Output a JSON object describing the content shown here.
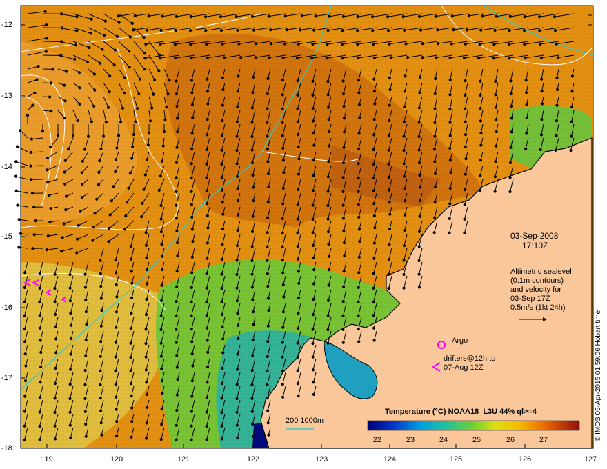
{
  "map": {
    "date": "03-Sep-2008",
    "time": "17:10Z",
    "legend_lines": [
      "Altimetric sealevel",
      "(0.1m contours)",
      "and velocity for",
      "03-Sep 17Z",
      "0.5m/s (1kt 24h)"
    ],
    "argo_label": "Argo",
    "drifters_label_1": "drifters@12h to",
    "drifters_label_2": "07-Aug 12Z",
    "bathy_label": "200  1000m",
    "colorbar_title": "Temperature (°C) NOAA18_L3U 44% ql>=4",
    "colorbar_ticks": [
      "22",
      "23",
      "24",
      "25",
      "26",
      "27"
    ],
    "credit": "© IMOS 05-Apr-2015 01:59:06 Hobart time",
    "lat_ticks": [
      "-12",
      "-13",
      "-14",
      "-15",
      "-16",
      "-17",
      "-18"
    ],
    "lon_ticks": [
      "119",
      "120",
      "121",
      "122",
      "123",
      "124",
      "125",
      "126",
      "127"
    ],
    "colors": {
      "land": "#f9c79a",
      "sst_warm": "#e08a10",
      "sst_cool": "#9acd32",
      "contour": "#ffffff",
      "bathy": "#3cc6c0",
      "drifter": "#ff00ff"
    }
  }
}
